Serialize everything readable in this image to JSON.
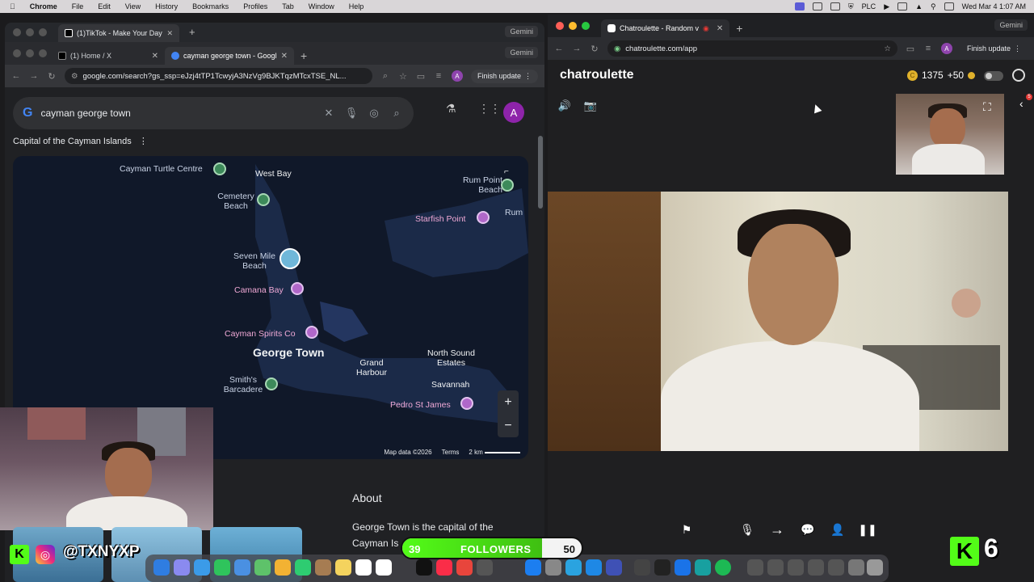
{
  "menubar": {
    "app": "Chrome",
    "items": [
      "File",
      "Edit",
      "View",
      "History",
      "Bookmarks",
      "Profiles",
      "Tab",
      "Window",
      "Help"
    ],
    "plc": "PLC",
    "datetime": "Wed Mar 4  1:07 AM"
  },
  "left_window": {
    "back_tabs": [
      {
        "label": "(1)TikTok - Make Your Day"
      }
    ],
    "tabs": [
      {
        "label": "(1) Home / X"
      },
      {
        "label": "cayman george town - Googl"
      }
    ],
    "gemini": "Gemini",
    "url": "google.com/search?gs_ssp=eJzj4tTP1TcwyjA3NzVg9BJKTqzMTcxTSE_NL...",
    "finish_update": "Finish update",
    "avatar_letter": "A"
  },
  "google": {
    "query": "cayman george town",
    "caption": "Capital of the Cayman Islands",
    "avatar_letter": "A",
    "map": {
      "labels": [
        "Cayman Turtle Centre",
        "West Bay",
        "Cemetery Beach",
        "Rum Point Beach",
        "Starfish Point",
        "Rum",
        "Seven Mile Beach",
        "Camana Bay",
        "Cayman Spirits Co",
        "George Town",
        "Grand Harbour",
        "North Sound Estates",
        "Savannah",
        "Smith's Barcadere",
        "Pedro St James"
      ],
      "map_data": "Map data ©2026",
      "terms": "Terms",
      "scale": "2 km",
      "zoom_in": "+",
      "zoom_out": "−"
    },
    "about_heading": "About",
    "about_text": "George Town is the capital of the Cayman Is"
  },
  "right_window": {
    "tab_label": "Chatroulette - Random v",
    "url": "chatroulette.com/app",
    "gemini": "Gemini",
    "finish_update": "Finish update",
    "avatar_letter": "A"
  },
  "chatroulette": {
    "logo": "chatroulette",
    "coins": "1375",
    "bonus": "+50",
    "badge_count": "5"
  },
  "overlay": {
    "handle": "@TXNYXP",
    "followers_current": "39",
    "followers_label": "FOLLOWERS",
    "followers_goal": "50",
    "followers_progress": 0.78,
    "kick_count": "6"
  },
  "colors": {
    "kick_green": "#53fc18",
    "chatroulette_bg": "#1f1f21",
    "google_bg": "#202124"
  }
}
